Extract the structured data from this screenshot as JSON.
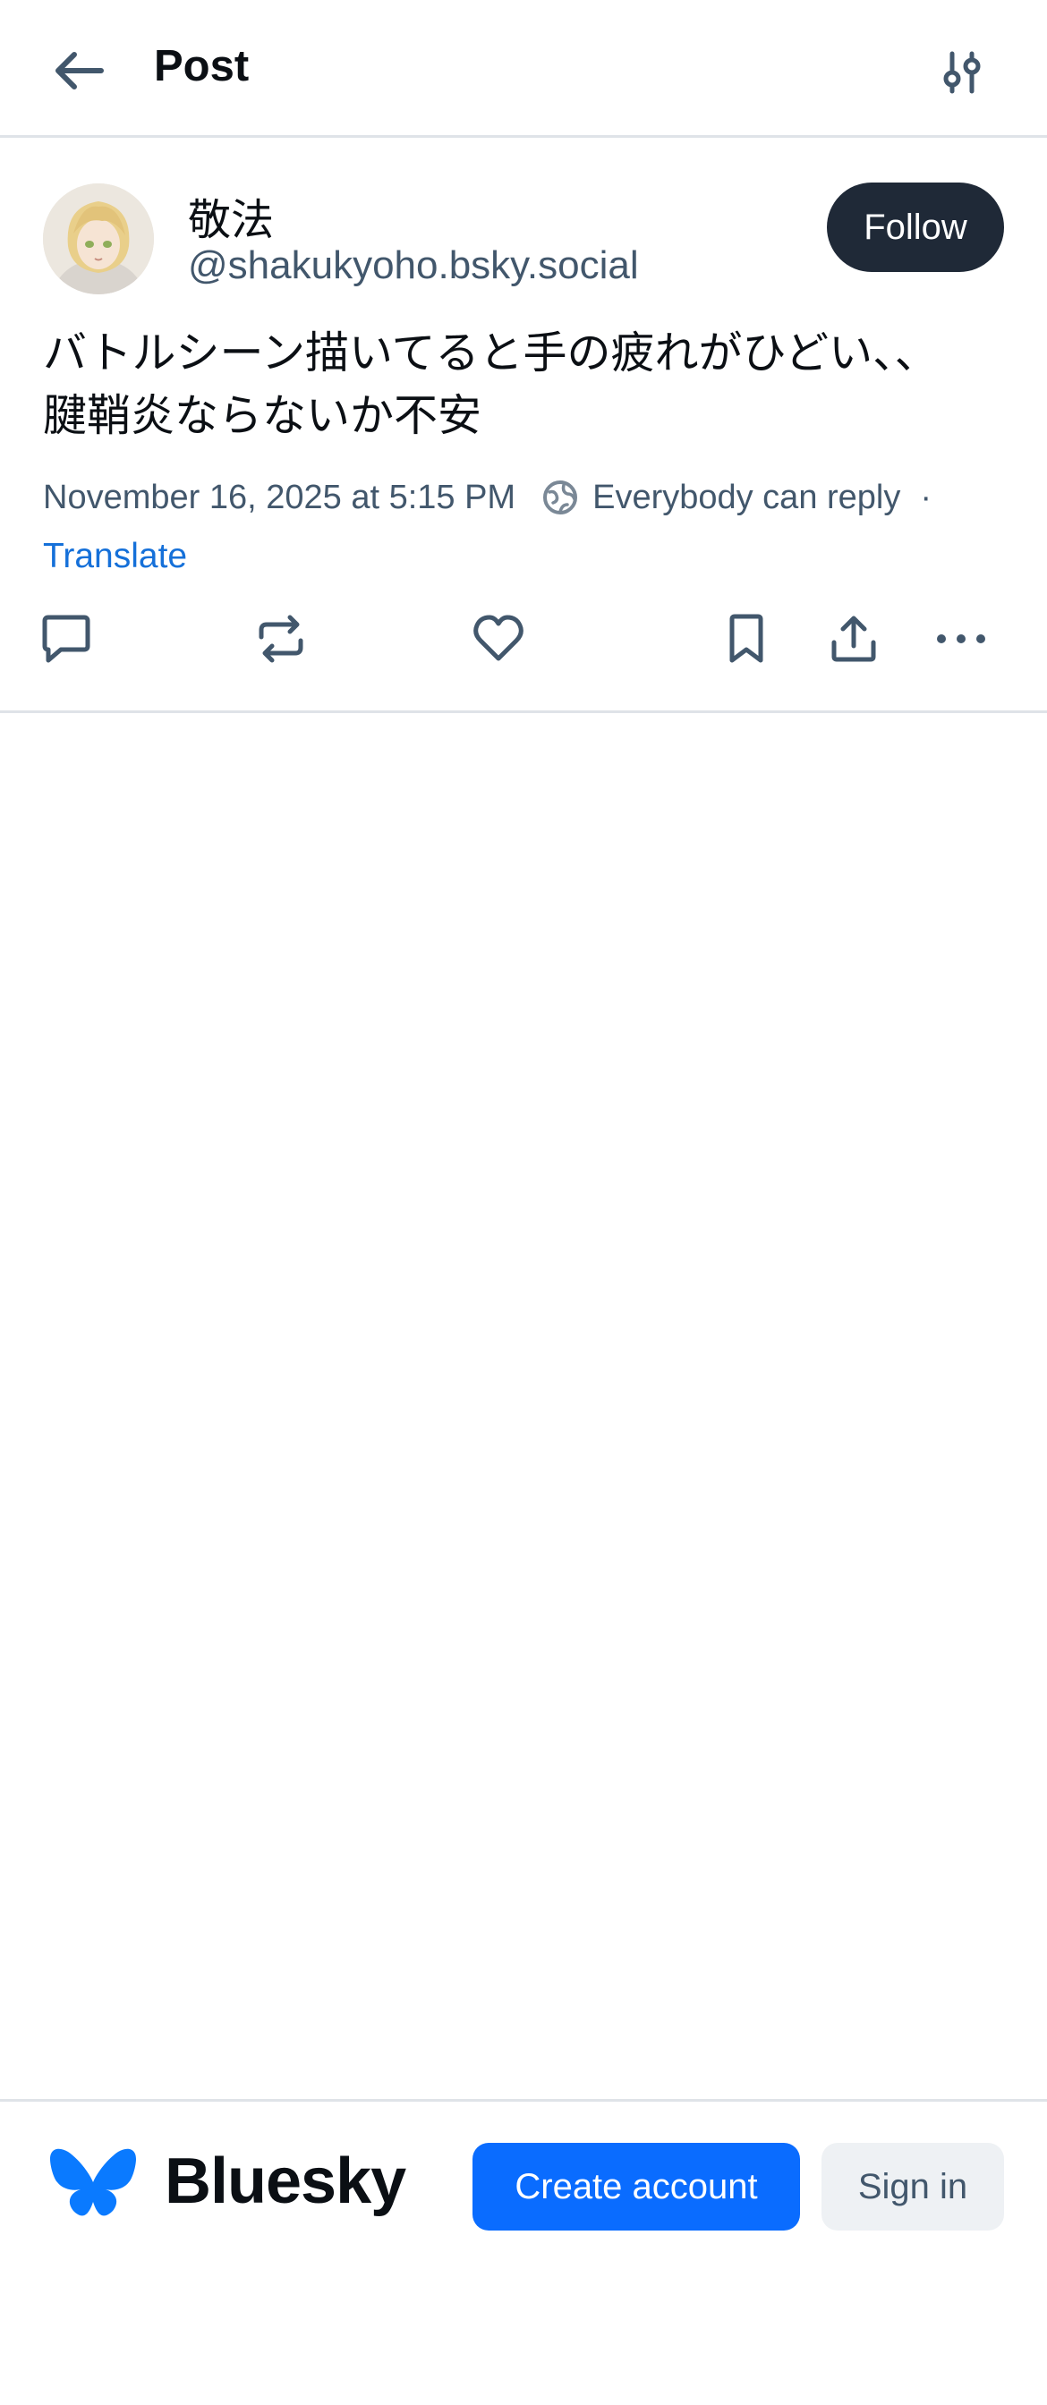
{
  "header": {
    "title": "Post",
    "back_icon": "arrow-left-icon",
    "filter_icon": "sliders-icon"
  },
  "post": {
    "author": {
      "display_name": "敬法",
      "handle": "@shakukyoho.bsky.social"
    },
    "follow_label": "Follow",
    "text_line1": "バトルシーン描いてると手の疲れがひどい、、",
    "text_line2": "腱鞘炎ならないか不安",
    "timestamp": "November 16, 2025 at 5:15 PM",
    "reply_setting": "Everybody can reply",
    "separator": "·",
    "translate_label": "Translate",
    "actions": [
      "reply-icon",
      "repost-icon",
      "like-icon",
      "bookmark-icon",
      "share-icon",
      "more-icon"
    ]
  },
  "footer": {
    "brand": "Bluesky",
    "create_account_label": "Create account",
    "sign_in_label": "Sign in"
  },
  "colors": {
    "accent": "#0a6cff",
    "link": "#1570d9",
    "follow_bg": "#1f2937",
    "secondary_text": "#42576c",
    "divider": "#dfe3e8"
  }
}
